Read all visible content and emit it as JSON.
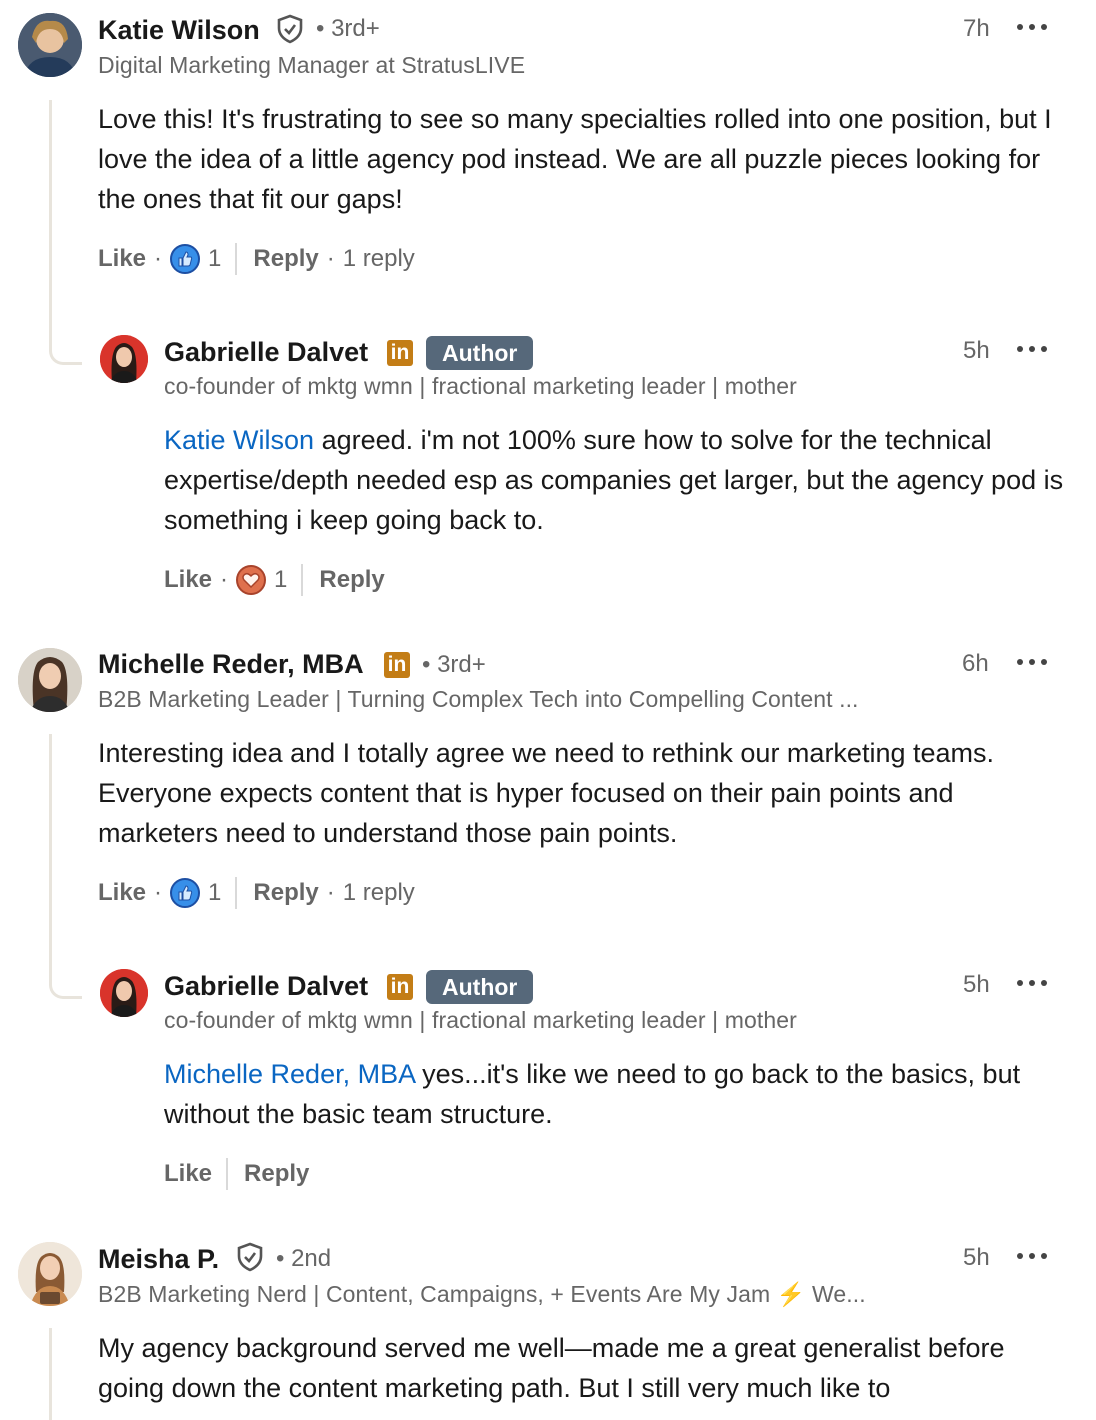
{
  "comments": [
    {
      "name": "Katie Wilson",
      "degree": "• 3rd+",
      "headline": "Digital Marketing Manager at StratusLIVE",
      "time": "7h",
      "text": "Love this! It's frustrating to see so many specialties rolled into one position, but I love the idea of a little agency pod instead. We are all puzzle pieces looking for the ones that fit our gaps!",
      "like_label": "Like",
      "reaction": "like",
      "reaction_count": "1",
      "reply_label": "Reply",
      "replies_label": "1 reply",
      "reply": {
        "name": "Gabrielle Dalvet",
        "badge": "Author",
        "headline": "co-founder of mktg wmn | fractional marketing leader | mother",
        "time": "5h",
        "mention": "Katie Wilson",
        "text": " agreed. i'm not 100% sure how to solve for the technical expertise/depth needed esp as companies get larger, but the agency pod is something i keep going back to.",
        "like_label": "Like",
        "reaction": "love",
        "reaction_count": "1",
        "reply_label": "Reply"
      }
    },
    {
      "name": "Michelle Reder, MBA",
      "degree": "• 3rd+",
      "headline": "B2B Marketing Leader | Turning Complex Tech into Compelling Content ...",
      "time": "6h",
      "text": "Interesting idea and I totally agree we need to rethink our marketing teams. Everyone expects content that is hyper focused on their pain points and marketers need to understand those pain points.",
      "like_label": "Like",
      "reaction": "like",
      "reaction_count": "1",
      "reply_label": "Reply",
      "replies_label": "1 reply",
      "reply": {
        "name": "Gabrielle Dalvet",
        "badge": "Author",
        "headline": "co-founder of mktg wmn | fractional marketing leader | mother",
        "time": "5h",
        "mention": "Michelle Reder, MBA",
        "text": " yes...it's like we need to go back to the basics, but without the basic team structure.",
        "like_label": "Like",
        "reply_label": "Reply"
      }
    },
    {
      "name": "Meisha P.",
      "degree": "• 2nd",
      "headline": "B2B Marketing Nerd | Content, Campaigns, + Events Are My Jam ⚡ We...",
      "time": "5h",
      "text": "My agency background served me well—made me a great generalist before going down the content marketing path. But I still very much like to"
    }
  ],
  "colors": {
    "mention": "#0a66c2",
    "author_badge": "#56687a",
    "linkedin_badge": "#c37d16",
    "like_reaction": "#378fe9",
    "love_reaction": "#df704d"
  },
  "icons": {
    "verified": "shield-check-icon",
    "linkedin": "linkedin-badge-icon",
    "more": "more-horizontal-icon"
  }
}
